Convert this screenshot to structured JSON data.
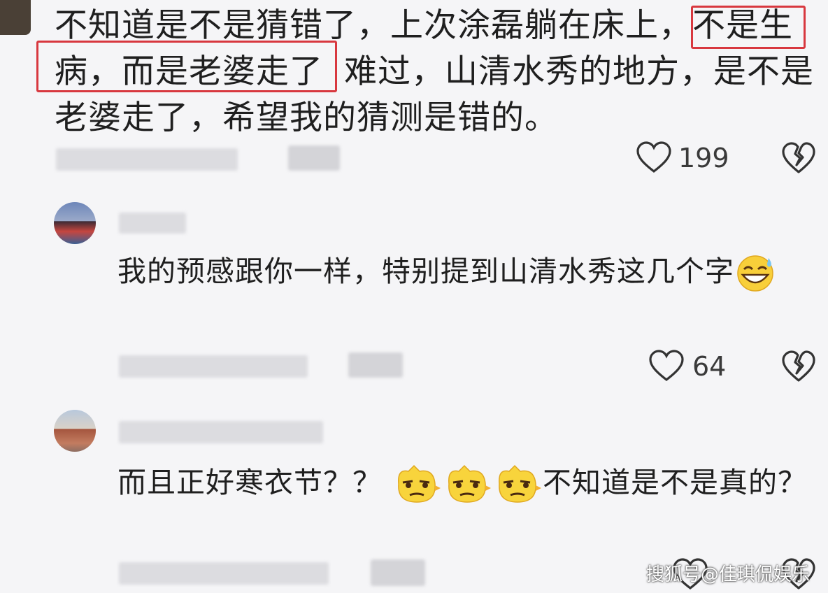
{
  "top_comment": {
    "text_part1": "不知道是不是猜错了，上次涂磊躺在床上，",
    "text_highlight": "不是生病，而是老婆走了",
    "text_part2": "难过，山清水秀的地方，是不是老婆走了，希望我的猜测是错的。",
    "like_count": "199"
  },
  "reply_1": {
    "text": "我的预感跟你一样，特别提到山清水秀这几个字",
    "emoji": "grinning-sweat-emoji",
    "like_count": "64"
  },
  "reply_2": {
    "text_before": "而且正好寒衣节？？",
    "emoji": "smirk-emoji",
    "text_after": "不知道是不是真的？"
  },
  "watermark": "搜狐号@佳琪侃娱乐",
  "colors": {
    "highlight": "#d8383f",
    "background": "#f5f5f7"
  }
}
